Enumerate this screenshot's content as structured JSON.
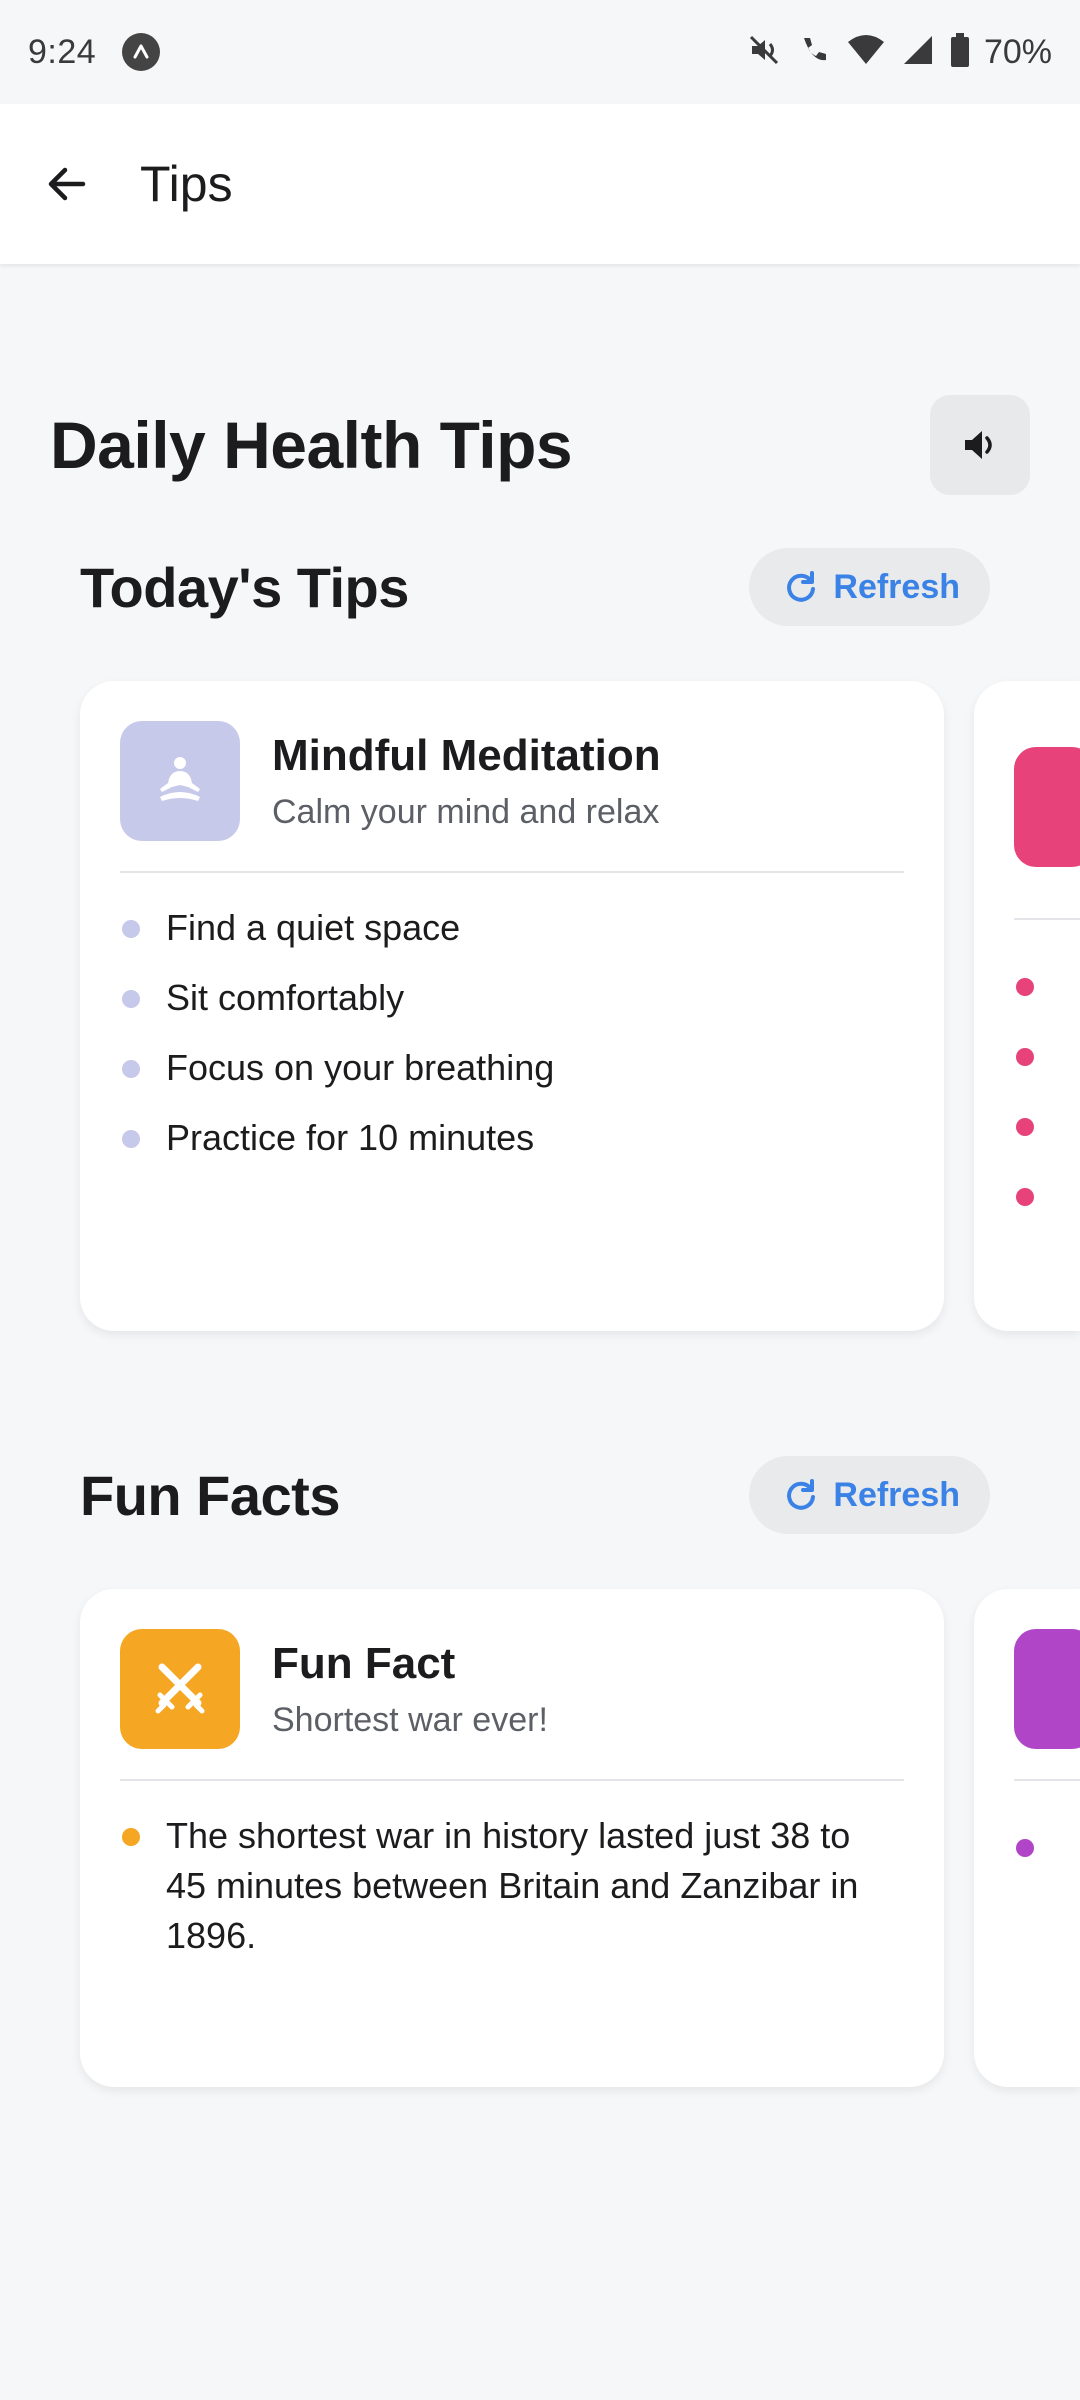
{
  "status_bar": {
    "time": "9:24",
    "battery": "70%",
    "icons": [
      "app-badge-icon",
      "mute-icon",
      "wifi-call-icon",
      "wifi-icon",
      "signal-icon",
      "battery-icon"
    ]
  },
  "app_bar": {
    "title": "Tips",
    "back_icon": "arrow-left-icon"
  },
  "page": {
    "title": "Daily Health Tips",
    "sound_icon": "volume-icon"
  },
  "sections": [
    {
      "title": "Today's Tips",
      "refresh_label": "Refresh",
      "card": {
        "title": "Mindful Meditation",
        "subtitle": "Calm your mind and relax",
        "icon": "meditation-icon",
        "icon_bg": "#c7c9ea",
        "dot_color": "#c7c9ea",
        "bullets": [
          "Find a quiet space",
          "Sit comfortably",
          "Focus on your breathing",
          "Practice for 10 minutes"
        ]
      },
      "peek_color": "#e8427a"
    },
    {
      "title": "Fun Facts",
      "refresh_label": "Refresh",
      "card": {
        "title": "Fun Fact",
        "subtitle": "Shortest war ever!",
        "icon": "crossed-swords-icon",
        "icon_bg": "#f5a623",
        "dot_color": "#f5a623",
        "bullets": [
          "The shortest war in history lasted just 38 to 45 minutes between Britain and Zanzibar in 1896."
        ]
      },
      "peek_color": "#b045c8"
    }
  ],
  "colors": {
    "accent": "#3b82e6",
    "background": "#f6f7f9"
  }
}
